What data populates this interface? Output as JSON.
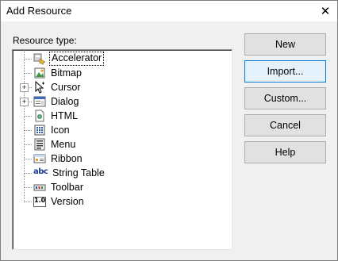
{
  "window": {
    "title": "Add Resource",
    "close_glyph": "✕"
  },
  "resource_type_label": "Resource type:",
  "tree": {
    "items": [
      {
        "label": "Accelerator",
        "icon": "accelerator-icon",
        "expandable": false,
        "selected": true
      },
      {
        "label": "Bitmap",
        "icon": "bitmap-icon",
        "expandable": false
      },
      {
        "label": "Cursor",
        "icon": "cursor-icon",
        "expandable": true,
        "expander": "+"
      },
      {
        "label": "Dialog",
        "icon": "dialog-icon",
        "expandable": true,
        "expander": "+"
      },
      {
        "label": "HTML",
        "icon": "html-icon",
        "expandable": false
      },
      {
        "label": "Icon",
        "icon": "icon-resource-icon",
        "expandable": false
      },
      {
        "label": "Menu",
        "icon": "menu-icon",
        "expandable": false
      },
      {
        "label": "Ribbon",
        "icon": "ribbon-icon",
        "expandable": false
      },
      {
        "label": "String Table",
        "icon": "string-table-icon",
        "icon_text": "abc",
        "expandable": false
      },
      {
        "label": "Toolbar",
        "icon": "toolbar-icon",
        "expandable": false
      },
      {
        "label": "Version",
        "icon": "version-icon",
        "icon_text": "1.0",
        "expandable": false
      }
    ]
  },
  "buttons": {
    "new": "New",
    "import": "Import...",
    "custom": "Custom...",
    "cancel": "Cancel",
    "help": "Help"
  },
  "colors": {
    "focus_border": "#0078d7",
    "focus_fill": "#e5f1fb",
    "button_fill": "#e1e1e1"
  }
}
